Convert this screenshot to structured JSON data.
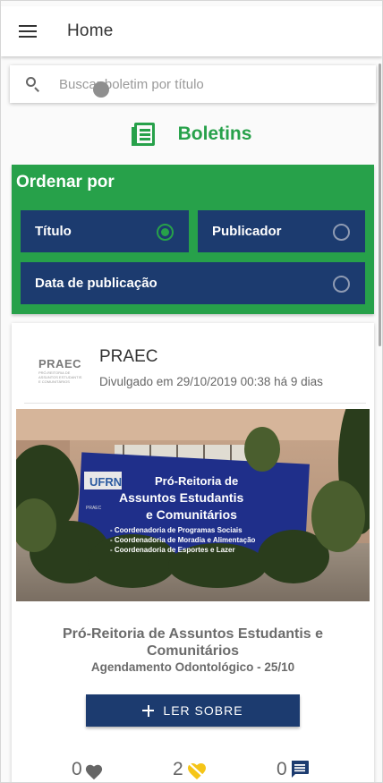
{
  "appbar": {
    "title": "Home"
  },
  "search": {
    "placeholder": "Buscar boletim por título"
  },
  "section": {
    "title": "Boletins",
    "icon": "newspaper-icon"
  },
  "sort": {
    "title": "Ordenar por",
    "options": [
      {
        "label": "Título",
        "selected": true
      },
      {
        "label": "Publicador",
        "selected": false
      },
      {
        "label": "Data de publicação",
        "selected": false
      }
    ]
  },
  "card": {
    "publisher": "PRAEC",
    "logo_text": "PRAEC",
    "logo_subtext": "PRÓ-REITORIA DE ASSUNTOS ESTUDANTIS E COMUNITÁRIOS",
    "date": "Divulgado em 29/10/2019 00:38 há 9 dias",
    "title": "Pró-Reitoria de Assuntos Estudantis e Comunitários",
    "subtitle": "Agendamento Odontológico - 25/10",
    "read_button": "LER SOBRE",
    "banner": {
      "brand": "UFRN",
      "heading_line1": "Pró-Reitoria de",
      "heading_line2": "Assuntos Estudantis",
      "heading_line3": "e Comunitários",
      "item1": "- Coordenadoria de Programas Sociais",
      "item2": "- Coordenadoria de Moradia e Alimentação",
      "item3": "- Coordenadoria de Esportes e Lazer"
    },
    "stats": {
      "likes": "0",
      "dislikes": "2",
      "comments": "0"
    }
  },
  "colors": {
    "green": "#27a14a",
    "navy": "#1c3b6f",
    "heart_broken": "#f5c518"
  }
}
